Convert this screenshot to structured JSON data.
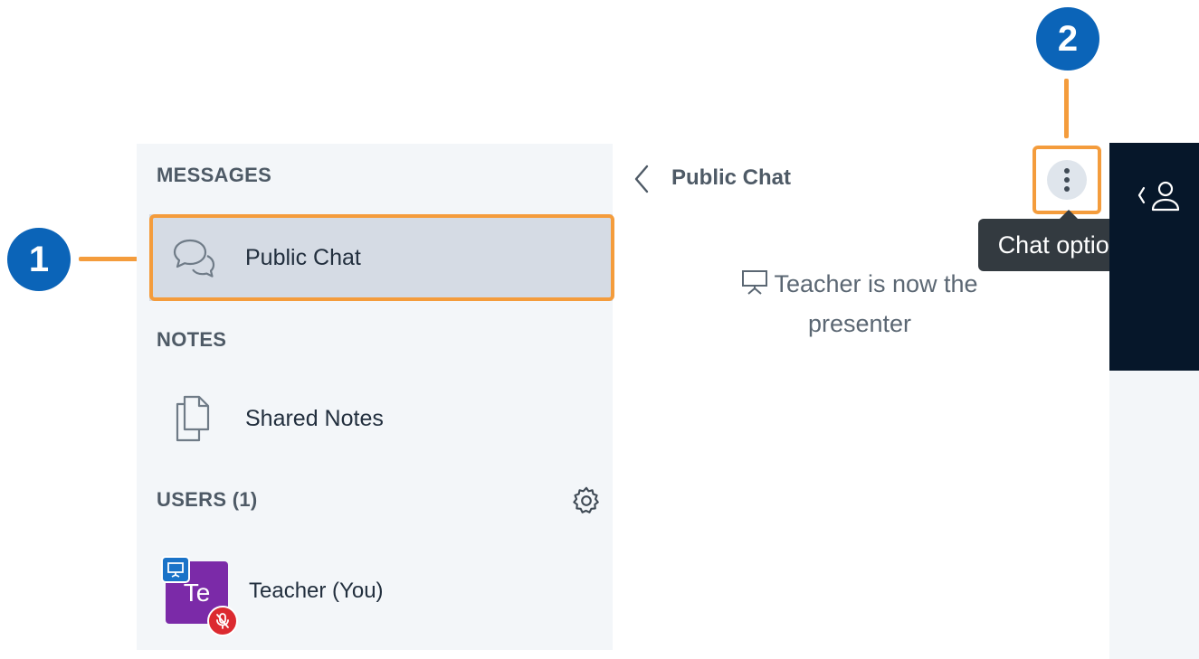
{
  "sidebar": {
    "messages_title": "MESSAGES",
    "public_chat_label": "Public Chat",
    "notes_title": "NOTES",
    "shared_notes_label": "Shared Notes",
    "users_title": "USERS (1)",
    "user": {
      "initials": "Te",
      "name": "Teacher (You)",
      "avatar_color": "#7b2aa8"
    }
  },
  "chat": {
    "title": "Public Chat",
    "options_tooltip": "Chat options",
    "system_message": "Teacher is now the presenter"
  },
  "callouts": {
    "one": "1",
    "two": "2"
  },
  "colors": {
    "highlight": "#f49c3c",
    "callout": "#0b64b8",
    "dark_panel": "#06172a",
    "sidebar_bg": "#f3f6f9"
  }
}
